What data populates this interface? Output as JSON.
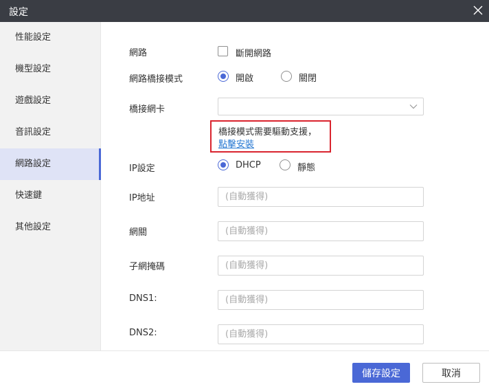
{
  "window": {
    "title": "設定"
  },
  "sidebar": {
    "items": [
      {
        "label": "性能設定"
      },
      {
        "label": "機型設定"
      },
      {
        "label": "遊戲設定"
      },
      {
        "label": "音訊設定"
      },
      {
        "label": "網路設定",
        "active": true
      },
      {
        "label": "快速鍵"
      },
      {
        "label": "其他設定"
      }
    ]
  },
  "network": {
    "label": "網路",
    "disconnect_label": "斷開網路",
    "disconnect_checked": false
  },
  "bridge_mode": {
    "label": "網路橋接模式",
    "on_label": "開啟",
    "off_label": "關閉",
    "selected": "on"
  },
  "bridge_nic": {
    "label": "橋接網卡",
    "value": ""
  },
  "notice": {
    "text": "橋接模式需要驅動支援，",
    "link": "點擊安裝",
    "border_color": "#d9232d",
    "link_color": "#2a7ad3"
  },
  "ip_settings": {
    "label": "IP設定",
    "dhcp_label": "DHCP",
    "static_label": "靜態",
    "selected": "dhcp"
  },
  "fields": {
    "ip": {
      "label": "IP地址",
      "placeholder": "(自動獲得)"
    },
    "gateway": {
      "label": "網關",
      "placeholder": "(自動獲得)"
    },
    "subnet": {
      "label": "子網掩碼",
      "placeholder": "(自動獲得)"
    },
    "dns1": {
      "label": "DNS1:",
      "placeholder": "(自動獲得)"
    },
    "dns2": {
      "label": "DNS2:",
      "placeholder": "(自動獲得)"
    }
  },
  "footer": {
    "save_label": "儲存設定",
    "cancel_label": "取消"
  },
  "colors": {
    "titlebar": "#3a3d44",
    "accent": "#4a68d6",
    "sidebar_bg": "#f2f2f2",
    "sidebar_active_bg": "#dfe3f6"
  },
  "icons": {
    "close": "close-icon",
    "dropdown": "chevron-down-icon"
  }
}
